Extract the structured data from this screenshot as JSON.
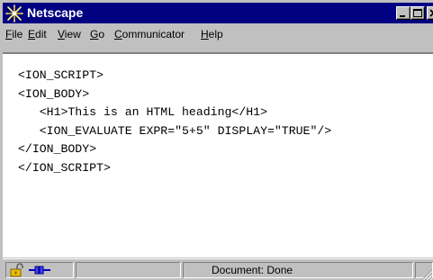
{
  "window": {
    "title": "Netscape"
  },
  "menu": {
    "items": [
      {
        "label": "File"
      },
      {
        "label": "Edit"
      },
      {
        "label": "View"
      },
      {
        "label": "Go"
      },
      {
        "label": "Communicator"
      },
      {
        "label": "Help"
      }
    ]
  },
  "content": {
    "lines": [
      "<ION_SCRIPT>",
      "<ION_BODY>",
      "   <H1>This is an HTML heading</H1>",
      "   <ION_EVALUATE EXPR=\"5+5\" DISPLAY=\"TRUE\"/>",
      "</ION_BODY>",
      "</ION_SCRIPT>"
    ]
  },
  "status": {
    "text": "Document: Done"
  },
  "icons": {
    "app": "netscape-star-icon",
    "security": "unlocked-padlock-icon",
    "connection": "connection-plug-icon"
  },
  "colors": {
    "titlebar": "#000080",
    "chrome": "#c0c0c0",
    "content_bg": "#ffffff"
  }
}
